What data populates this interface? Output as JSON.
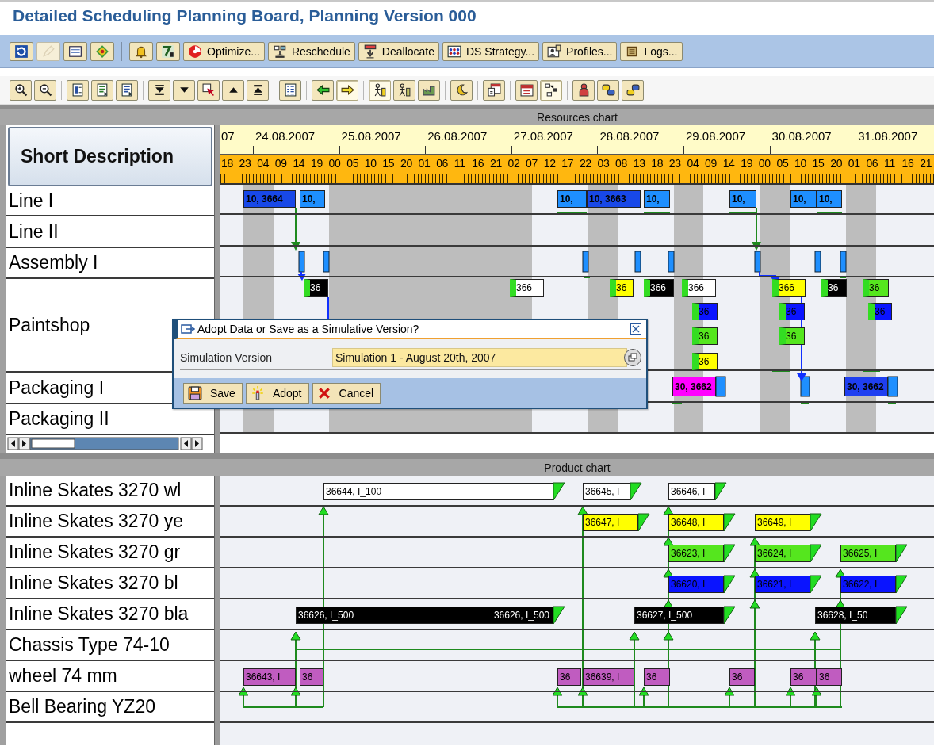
{
  "title": "Detailed Scheduling Planning Board, Planning Version 000",
  "toolbar": {
    "groups": [
      [
        {
          "kind": "refresh",
          "disabled": false
        },
        {
          "kind": "pencil",
          "disabled": true
        },
        {
          "kind": "list",
          "disabled": false
        },
        {
          "kind": "diamond",
          "disabled": false
        }
      ],
      [
        {
          "kind": "bell",
          "disabled": false
        },
        {
          "kind": "chart",
          "disabled": false
        },
        {
          "kind": "optimize",
          "label": "Optimize...",
          "disabled": false
        },
        {
          "kind": "reschedule",
          "label": "Reschedule",
          "disabled": false
        },
        {
          "kind": "deallocate",
          "label": "Deallocate",
          "disabled": false
        },
        {
          "kind": "strategy",
          "label": "DS Strategy...",
          "disabled": false
        },
        {
          "kind": "profiles",
          "label": "Profiles...",
          "disabled": false
        },
        {
          "kind": "logs",
          "label": "Logs...",
          "disabled": false
        }
      ]
    ]
  },
  "chart_toolbar": {
    "groups": [
      [
        {
          "kind": "zoom-in",
          "pressed": false
        },
        {
          "kind": "zoom-out",
          "pressed": false
        }
      ],
      [
        {
          "kind": "doc-a",
          "pressed": false
        },
        {
          "kind": "doc-b",
          "pressed": false
        },
        {
          "kind": "doc-c",
          "pressed": false
        }
      ],
      [
        {
          "kind": "bottom",
          "pressed": false
        },
        {
          "kind": "down",
          "pressed": false
        },
        {
          "kind": "pointer",
          "pressed": false
        },
        {
          "kind": "up",
          "pressed": false
        },
        {
          "kind": "top",
          "pressed": false
        }
      ],
      [
        {
          "kind": "checklist",
          "pressed": false
        }
      ],
      [
        {
          "kind": "left",
          "pressed": false
        },
        {
          "kind": "right",
          "pressed": true
        }
      ],
      [
        {
          "kind": "figure",
          "pressed": true
        },
        {
          "kind": "figure2",
          "pressed": false
        },
        {
          "kind": "factory",
          "pressed": false
        }
      ],
      [
        {
          "kind": "moon",
          "pressed": false
        }
      ],
      [
        {
          "kind": "calendar-check",
          "pressed": false
        }
      ],
      [
        {
          "kind": "calendar",
          "pressed": false
        },
        {
          "kind": "network",
          "pressed": true
        }
      ],
      [
        {
          "kind": "person",
          "pressed": false
        },
        {
          "kind": "chat-right",
          "pressed": false
        },
        {
          "kind": "chat-left",
          "pressed": false
        }
      ]
    ]
  },
  "resources_chart": {
    "title": "Resources chart",
    "column_header": "Short Description",
    "dates": [
      "07",
      "24.08.2007",
      "25.08.2007",
      "26.08.2007",
      "27.08.2007",
      "28.08.2007",
      "29.08.2007",
      "30.08.2007",
      "31.08.2007"
    ],
    "hours": [
      "18",
      "23",
      "04",
      "09",
      "14",
      "19",
      "00",
      "05",
      "10",
      "15",
      "20",
      "01",
      "06",
      "11",
      "16",
      "21",
      "02",
      "07",
      "12",
      "17",
      "22",
      "03",
      "08",
      "13",
      "18",
      "23",
      "04",
      "09",
      "14",
      "19",
      "00",
      "05",
      "10",
      "15",
      "20",
      "01",
      "06",
      "11",
      "16",
      "21"
    ],
    "rows": [
      {
        "name": "Line I",
        "bars": [
          {
            "label": "10, 3664",
            "color": "#1848e8"
          },
          {
            "label": "10,",
            "color": "#1e8fff"
          },
          {
            "label": "10,",
            "color": "#1e8fff"
          },
          {
            "label": "10, 3663",
            "color": "#1848e8"
          },
          {
            "label": "10,",
            "color": "#1e8fff"
          },
          {
            "label": "10,",
            "color": "#1e8fff"
          },
          {
            "label": "10,",
            "color": "#1e8fff"
          },
          {
            "label": "10,",
            "color": "#1e8fff"
          }
        ]
      },
      {
        "name": "Line II",
        "bars": []
      },
      {
        "name": "Assembly I",
        "bars": []
      },
      {
        "name": "Paintshop",
        "bars": [
          {
            "label": "36",
            "color": "#000000"
          },
          {
            "label": "366",
            "color": "#ffffff"
          },
          {
            "label": "36",
            "color": "#ffff00"
          },
          {
            "label": "366",
            "color": "#000000"
          },
          {
            "label": "366",
            "color": "#ffffff"
          },
          {
            "label": "366",
            "color": "#ffff00"
          },
          {
            "label": "36",
            "color": "#000000"
          },
          {
            "label": "36",
            "color": "#55e61e"
          },
          {
            "label": "36",
            "color": "#0a14ff"
          },
          {
            "label": "36",
            "color": "#0a14ff"
          },
          {
            "label": "36",
            "color": "#0a14ff"
          },
          {
            "label": "36",
            "color": "#55e61e"
          },
          {
            "label": "36",
            "color": "#55e61e"
          },
          {
            "label": "36",
            "color": "#ffff00"
          }
        ]
      },
      {
        "name": "Packaging I",
        "bars": [
          {
            "label": "30, 3662",
            "color": "#ff00ff"
          },
          {
            "label": "30, 3662",
            "color": "#1f3ff0"
          }
        ]
      },
      {
        "name": "Packaging II",
        "bars": []
      }
    ]
  },
  "dialog": {
    "title": "Adopt Data or Save as a Simulative Version?",
    "field_label": "Simulation Version",
    "field_value": "Simulation 1 - August 20th, 2007",
    "buttons": [
      {
        "kind": "save",
        "label": "Save"
      },
      {
        "kind": "adopt",
        "label": "Adopt"
      },
      {
        "kind": "cancel",
        "label": "Cancel"
      }
    ]
  },
  "product_chart": {
    "title": "Product chart",
    "rows": [
      {
        "name": "Inline Skates 3270 wl",
        "bars": [
          {
            "label": "36644, I_100",
            "color": "#ffffff"
          },
          {
            "label": "36645, I",
            "color": "#ffffff"
          },
          {
            "label": "36646, I",
            "color": "#ffffff"
          }
        ]
      },
      {
        "name": "Inline Skates 3270 ye",
        "bars": [
          {
            "label": "36647, I",
            "color": "#ffff00"
          },
          {
            "label": "36648, I",
            "color": "#ffff00"
          },
          {
            "label": "36649, I",
            "color": "#ffff00"
          }
        ]
      },
      {
        "name": "Inline Skates 3270 gr",
        "bars": [
          {
            "label": "36623, I",
            "color": "#55e61e"
          },
          {
            "label": "36624, I",
            "color": "#55e61e"
          },
          {
            "label": "36625, I",
            "color": "#55e61e"
          }
        ]
      },
      {
        "name": "Inline Skates 3270 bl",
        "bars": [
          {
            "label": "36620, I",
            "color": "#0a14ff"
          },
          {
            "label": "36621, I",
            "color": "#0a14ff"
          },
          {
            "label": "36622, I",
            "color": "#0a14ff"
          }
        ]
      },
      {
        "name": "Inline Skates 3270 bla",
        "bars": [
          {
            "label": "36626, I_500",
            "end_label": "36626, I_500",
            "color": "#000000"
          },
          {
            "label": "36627, I_500",
            "color": "#000000"
          },
          {
            "label": "36628, I_50",
            "color": "#000000"
          }
        ]
      },
      {
        "name": "Chassis Type 74-10",
        "bars": []
      },
      {
        "name": "wheel 74 mm",
        "bars": [
          {
            "label": "36643, I",
            "color": "#c05cc0"
          },
          {
            "label": "36",
            "color": "#c05cc0"
          },
          {
            "label": "36",
            "color": "#c05cc0"
          },
          {
            "label": "36639, I",
            "color": "#c05cc0"
          },
          {
            "label": "36",
            "color": "#c05cc0"
          },
          {
            "label": "36",
            "color": "#c05cc0"
          },
          {
            "label": "36",
            "color": "#c05cc0"
          },
          {
            "label": "36",
            "color": "#c05cc0"
          }
        ]
      },
      {
        "name": "Bell Bearing YZ20",
        "bars": []
      }
    ]
  }
}
